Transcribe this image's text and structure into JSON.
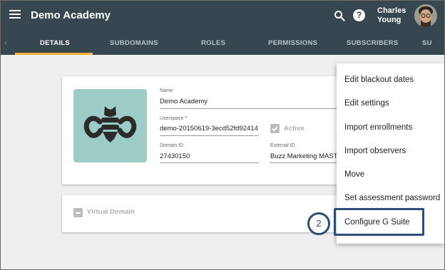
{
  "app": {
    "title": "Demo Academy"
  },
  "user": {
    "first_name": "Charles",
    "last_name": "Young"
  },
  "tabs": [
    {
      "label": "DETAILS",
      "active": true
    },
    {
      "label": "SUBDOMAINS"
    },
    {
      "label": "ROLES"
    },
    {
      "label": "PERMISSIONS"
    },
    {
      "label": "SUBSCRIBERS"
    },
    {
      "label": "SU"
    }
  ],
  "details": {
    "name_label": "Name",
    "name_value": "Demo Academy",
    "userspace_label": "Userspace *",
    "userspace_value": "demo-20150619-3ecd52fd92414",
    "active_label": "Active",
    "active_checked": true,
    "domain_id_label": "Domain ID",
    "domain_id_value": "27430150",
    "external_id_label": "External ID",
    "external_id_value": "Buzz Marketing MASTER"
  },
  "virtual_domain": {
    "label": "Virtual Domain",
    "checked": false
  },
  "menu": {
    "items": [
      "Edit blackout dates",
      "Edit settings",
      "Import enrollments",
      "Import observers",
      "Move",
      "Set assessment password",
      "Configure G Suite"
    ],
    "highlighted_index": 6
  },
  "callout": {
    "number": "2"
  },
  "colors": {
    "appbar": "#37474f",
    "tab_indicator": "#f5b335",
    "logo_bg": "#9dcbc6",
    "callout": "#2e4d7c"
  },
  "icons": {
    "menu": "hamburger-icon",
    "search": "search-icon",
    "help": "help-icon",
    "logo": "bee-logo-icon"
  }
}
